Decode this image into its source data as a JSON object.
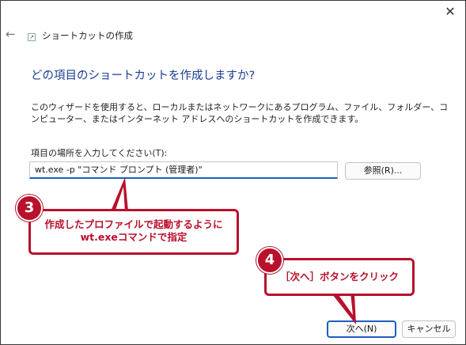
{
  "window": {
    "title": "ショートカットの作成",
    "close_label": "✕",
    "back_label": "←"
  },
  "heading": "どの項目のショートカットを作成しますか?",
  "description": "このウィザードを使用すると、ローカルまたはネットワークにあるプログラム、ファイル、フォルダー、コンピューター、またはインターネット アドレスへのショートカットを作成できます。",
  "location": {
    "label": "項目の場所を入力してください(T):",
    "value": "wt.exe -p \"コマンド プロンプト (管理者)\""
  },
  "buttons": {
    "browse": "参照(R)...",
    "next": "次へ(N)",
    "cancel": "キャンセル"
  },
  "callout3": {
    "number": "3",
    "line1": "作成したプロファイルで起動するように",
    "line2": "wt.exeコマンドで指定"
  },
  "callout4": {
    "number": "4",
    "text": "［次へ］ボタンをクリック"
  },
  "colors": {
    "accent": "#1f5fbf",
    "callout": "#b8112c",
    "heading": "#1b3d8f"
  }
}
